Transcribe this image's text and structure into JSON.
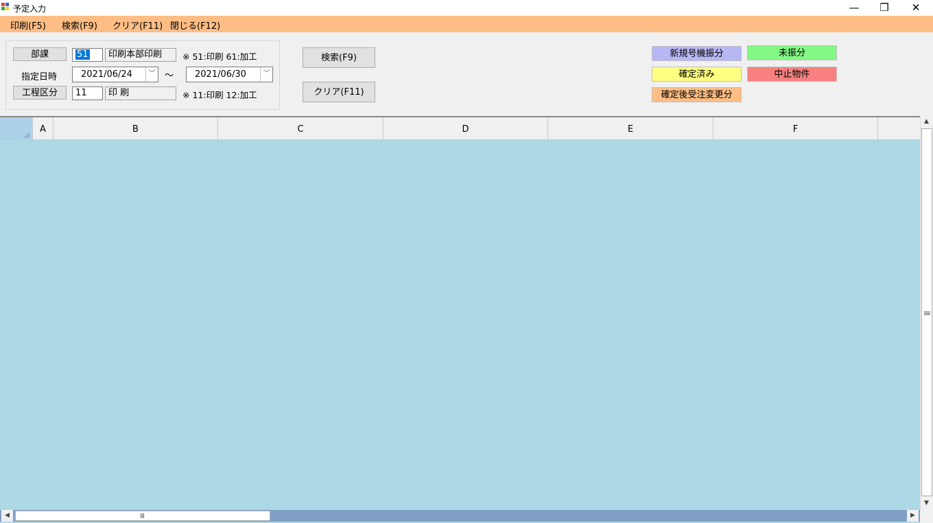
{
  "window": {
    "title": "予定入力",
    "minimize": "—",
    "restore": "❐",
    "close": "✕"
  },
  "menu": {
    "items": [
      "印刷(F5)",
      "検索(F9)",
      "クリア(F11)",
      "閉じる(F12)"
    ]
  },
  "filters": {
    "department": {
      "label": "部課",
      "code": "51",
      "name": "印刷本部印刷",
      "note": "※ 51:印刷 61:加工"
    },
    "date": {
      "label": "指定日時",
      "from": "2021/06/24",
      "separator": "～",
      "to": "2021/06/30"
    },
    "process": {
      "label": "工程区分",
      "code": "11",
      "name": "印 刷",
      "note": "※ 11:印刷 12:加工"
    }
  },
  "actions": {
    "search": "検索(F9)",
    "clear": "クリア(F11)"
  },
  "legend": [
    {
      "label": "新規号機振分",
      "color": "#b7b7f5"
    },
    {
      "label": "未振分",
      "color": "#84f884"
    },
    {
      "label": "確定済み",
      "color": "#ffff80"
    },
    {
      "label": "中止物件",
      "color": "#f88080"
    },
    {
      "label": "確定後受注変更分",
      "color": "#fdbd84"
    }
  ],
  "grid": {
    "columns": [
      "A",
      "B",
      "C",
      "D",
      "E",
      "F"
    ]
  }
}
